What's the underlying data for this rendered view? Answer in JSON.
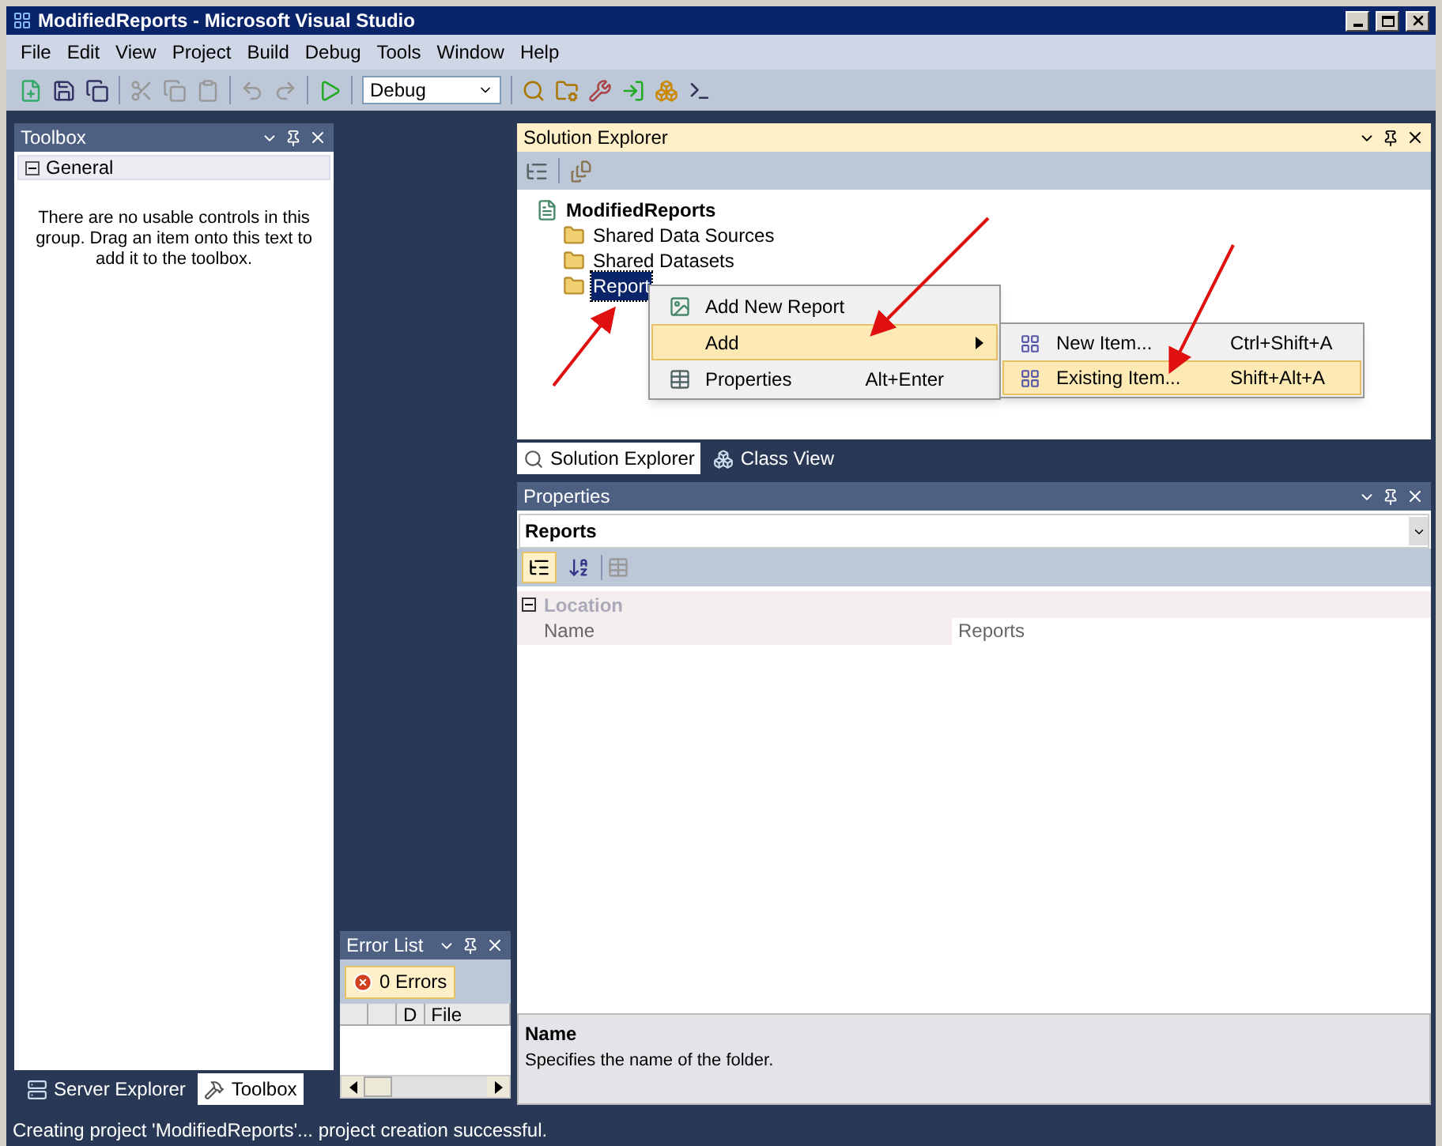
{
  "window": {
    "title": "ModifiedReports - Microsoft Visual Studio"
  },
  "menu": [
    "File",
    "Edit",
    "View",
    "Project",
    "Build",
    "Debug",
    "Tools",
    "Window",
    "Help"
  ],
  "toolbar": {
    "configuration": "Debug"
  },
  "toolbox": {
    "title": "Toolbox",
    "group": {
      "label": "General",
      "expanded": true
    },
    "empty_text": "There are no usable controls in this group. Drag an item onto this text to add it to the toolbox.",
    "tabs": [
      {
        "label": "Server Explorer",
        "selected": false
      },
      {
        "label": "Toolbox",
        "selected": true
      }
    ]
  },
  "error_list": {
    "title": "Error List",
    "errors_button": "0 Errors",
    "columns": [
      "D",
      "File"
    ]
  },
  "solution_explorer": {
    "title": "Solution Explorer",
    "active": true,
    "project": "ModifiedReports",
    "items": [
      {
        "label": "Shared Data Sources",
        "selected": false
      },
      {
        "label": "Shared Datasets",
        "selected": false
      },
      {
        "label": "Report",
        "selected": true
      }
    ],
    "tabs": [
      {
        "label": "Solution Explorer",
        "selected": true
      },
      {
        "label": "Class View",
        "selected": false
      }
    ]
  },
  "context_menu": {
    "items": [
      {
        "label": "Add New Report",
        "selected": false,
        "submenu": false
      },
      {
        "label": "Add",
        "selected": true,
        "submenu": true
      },
      {
        "label": "Properties",
        "shortcut": "Alt+Enter",
        "selected": false,
        "submenu": false
      }
    ]
  },
  "submenu": {
    "items": [
      {
        "label": "New Item...",
        "shortcut": "Ctrl+Shift+A",
        "selected": false
      },
      {
        "label": "Existing Item...",
        "shortcut": "Shift+Alt+A",
        "selected": true
      }
    ]
  },
  "properties": {
    "title": "Properties",
    "active": false,
    "object": "Reports",
    "categorized": true,
    "category": {
      "label": "Location",
      "expanded": true
    },
    "rows": [
      {
        "name": "Name",
        "value": "Reports"
      }
    ],
    "description": {
      "title": "Name",
      "text": "Specifies the name of the folder."
    }
  },
  "status_bar": "Creating project 'ModifiedReports'... project creation successful."
}
